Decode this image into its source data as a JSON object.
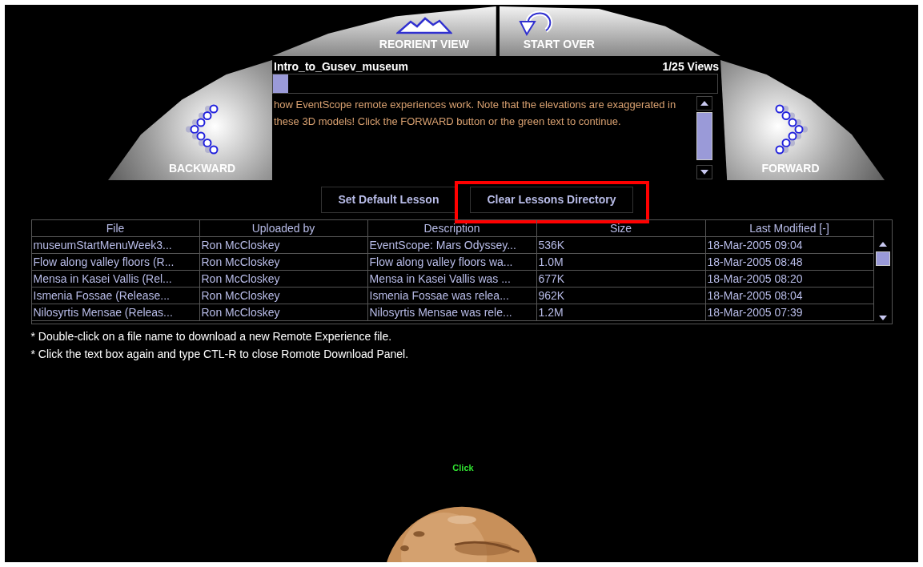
{
  "nav_buttons": {
    "reorient": "REORIENT VIEW",
    "start_over": "START OVER",
    "backward": "BACKWARD",
    "forward": "FORWARD"
  },
  "lesson": {
    "title": "Intro_to_Gusev_museum",
    "views": "1/25 Views",
    "progress": {
      "level": 0.035
    },
    "text": "how EventScope remote experiences work. Note that the elevations are exaggerated in these 3D models! Click the FORWARD button or the green text to continue."
  },
  "actions": [
    {
      "label": "Set Default Lesson",
      "highlighted": false
    },
    {
      "label": "Clear Lessons Directory",
      "highlighted": true
    }
  ],
  "table": {
    "columns": [
      "File",
      "Uploaded by",
      "Description",
      "Size",
      "Last Modified [-]"
    ],
    "rows": [
      [
        "museumStartMenuWeek3...",
        "Ron McCloskey",
        "EventScope: Mars Odyssey...",
        "536K",
        "18-Mar-2005 09:04"
      ],
      [
        "Flow along valley floors (R...",
        "Ron McCloskey",
        "Flow along valley floors wa...",
        "1.0M",
        "18-Mar-2005 08:48"
      ],
      [
        "Mensa in Kasei Vallis (Rel...",
        "Ron McCloskey",
        "Mensa in Kasei Vallis was ...",
        "677K",
        "18-Mar-2005 08:20"
      ],
      [
        "Ismenia Fossae (Release...",
        "Ron McCloskey",
        "Ismenia Fossae was relea...",
        "962K",
        "18-Mar-2005 08:04"
      ],
      [
        "Nilosyrtis Mensae (Releas...",
        "Ron McCloskey",
        "Nilosyrtis Mensae was rele...",
        "1.2M",
        "18-Mar-2005 07:39"
      ]
    ]
  },
  "notes": [
    "* Double-click on a file name to download a new Remote Experience file.",
    "* Click the text box again and type CTL-R to close Romote Download Panel."
  ],
  "scene": {
    "label": "Click"
  }
}
